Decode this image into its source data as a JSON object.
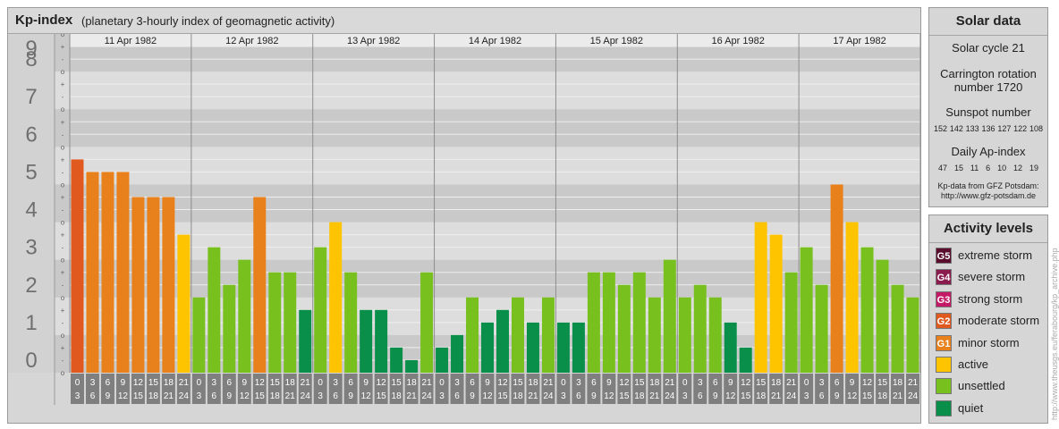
{
  "header": {
    "title": "Kp-index",
    "subtitle": "(planetary 3-hourly index of geomagnetic activity)"
  },
  "chart_data": {
    "type": "bar",
    "title": "Kp-index",
    "subtitle": "(planetary 3-hourly index of geomagnetic activity)",
    "ylim": [
      0,
      9
    ],
    "y_ticks": [
      "0",
      "1",
      "2",
      "3",
      "4",
      "5",
      "6",
      "7",
      "8",
      "9"
    ],
    "minor_y_ticks": [
      "o",
      "-",
      "+",
      "o",
      "-",
      "+",
      "o",
      "-",
      "+",
      "o",
      "-",
      "+",
      "o",
      "-",
      "+",
      "o",
      "-",
      "+",
      "o",
      "-",
      "+",
      "o",
      "-",
      "+",
      "o",
      "-",
      "+",
      "o"
    ],
    "days": [
      "11 Apr 1982",
      "12 Apr 1982",
      "13 Apr 1982",
      "14 Apr 1982",
      "15 Apr 1982",
      "16 Apr 1982",
      "17 Apr 1982"
    ],
    "interval_start": [
      "0",
      "3",
      "6",
      "9",
      "12",
      "15",
      "18",
      "21"
    ],
    "interval_end": [
      "3",
      "6",
      "9",
      "12",
      "15",
      "18",
      "21",
      "24"
    ],
    "values": [
      [
        5.667,
        5.333,
        5.333,
        5.333,
        4.667,
        4.667,
        4.667,
        3.667
      ],
      [
        2.0,
        3.333,
        2.333,
        3.0,
        4.667,
        2.667,
        2.667,
        1.667
      ],
      [
        3.333,
        4.0,
        2.667,
        1.667,
        1.667,
        0.667,
        0.333,
        2.667
      ],
      [
        0.667,
        1.0,
        2.0,
        1.333,
        1.667,
        2.0,
        1.333,
        2.0
      ],
      [
        1.333,
        1.333,
        2.667,
        2.667,
        2.333,
        2.667,
        2.0,
        3.0
      ],
      [
        2.0,
        2.333,
        2.0,
        1.333,
        0.667,
        4.0,
        3.667,
        2.667
      ],
      [
        3.333,
        2.333,
        5.0,
        4.0,
        3.333,
        3.0,
        2.333,
        2.0
      ]
    ],
    "colors": {
      "quiet": "#0a8f4a",
      "unsettled": "#78c01e",
      "active": "#ffc400",
      "G1": "#e8801b",
      "G2": "#e05a20",
      "G3": "#c41966",
      "G4": "#8a1b4f",
      "G5": "#5a0d2c"
    }
  },
  "solar": {
    "title": "Solar data",
    "cycle": "Solar cycle 21",
    "carrington_line1": "Carrington rotation",
    "carrington_line2": "number 1720",
    "sunspot_label": "Sunspot number",
    "sunspots": [
      "152",
      "142",
      "133",
      "136",
      "127",
      "122",
      "108"
    ],
    "ap_label": "Daily Ap-index",
    "ap": [
      "47",
      "15",
      "11",
      "6",
      "10",
      "12",
      "19"
    ],
    "source_line1": "Kp-data from GFZ Potsdam:",
    "source_line2": "http://www.gfz-potsdam.de"
  },
  "levels": {
    "title": "Activity levels",
    "items": [
      {
        "badge": "G5",
        "label": "extreme storm",
        "color": "#5a0d2c"
      },
      {
        "badge": "G4",
        "label": "severe storm",
        "color": "#8a1b4f"
      },
      {
        "badge": "G3",
        "label": "strong storm",
        "color": "#c41966"
      },
      {
        "badge": "G2",
        "label": "moderate storm",
        "color": "#e05a20"
      },
      {
        "badge": "G1",
        "label": "minor storm",
        "color": "#e8801b"
      },
      {
        "badge": "",
        "label": "active",
        "color": "#ffc400"
      },
      {
        "badge": "",
        "label": "unsettled",
        "color": "#78c01e"
      },
      {
        "badge": "",
        "label": "quiet",
        "color": "#0a8f4a"
      }
    ]
  },
  "credit": "http://www.theusgs.eu/ferabourg/kp_archive.php"
}
